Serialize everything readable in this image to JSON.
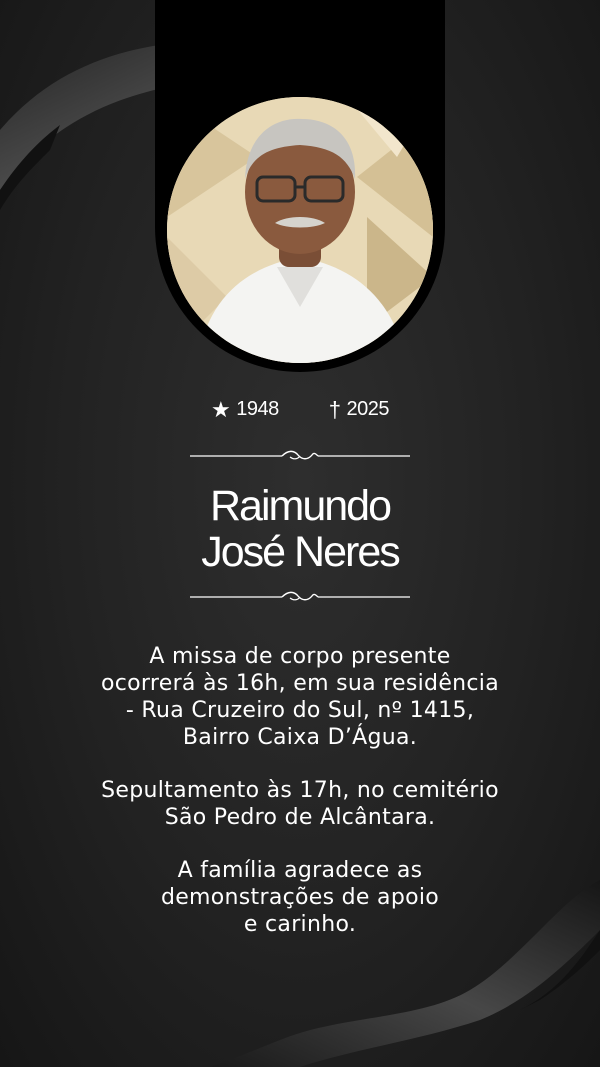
{
  "born": {
    "icon": "star-icon",
    "year": "1948"
  },
  "died": {
    "icon": "cross-icon",
    "year": "2025"
  },
  "name": {
    "line1": "Raimundo",
    "line2": "José Neres"
  },
  "message": {
    "p1": [
      "A missa de corpo presente",
      "ocorrerá às 16h, em sua residência",
      "-  Rua Cruzeiro do Sul, nº 1415,",
      "Bairro Caixa D’Água."
    ],
    "p2": [
      "Sepultamento às 17h, no cemitério",
      "São Pedro de Alcântara."
    ],
    "p3": [
      "A família agradece as",
      "demonstrações de apoio",
      "e carinho."
    ]
  },
  "colors": {
    "background": "#222222",
    "banner": "#000000",
    "text": "#ffffff",
    "ribbon": "#3a3a3a"
  }
}
